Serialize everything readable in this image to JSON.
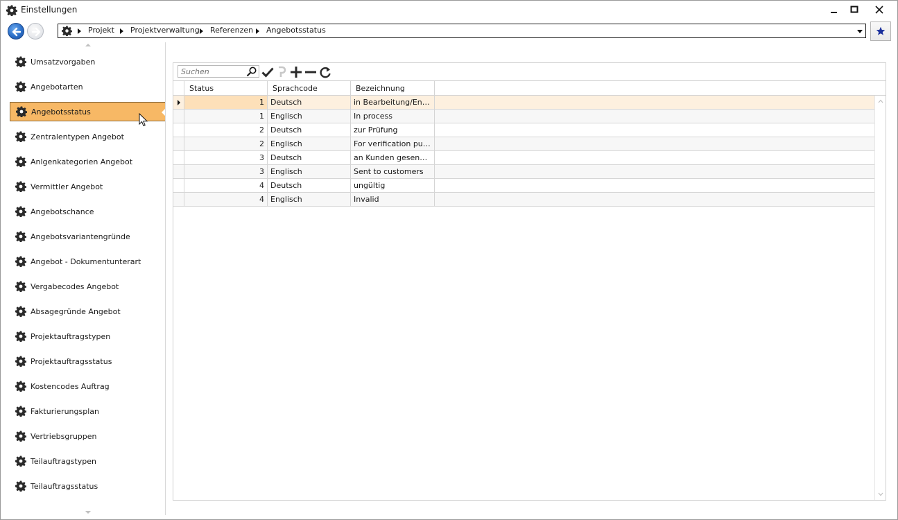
{
  "window": {
    "title": "Einstellungen"
  },
  "breadcrumb": [
    "Projekt",
    "Projektverwaltung",
    "Referenzen",
    "Angebotsstatus"
  ],
  "sidebar": {
    "selected_index": 2,
    "items": [
      "Umsatzvorgaben",
      "Angebotarten",
      "Angebotsstatus",
      "Zentralentypen Angebot",
      "Anlgenkategorien Angebot",
      "Vermittler Angebot",
      "Angebotschance",
      "Angebotsvariantengründe",
      "Angebot - Dokumentunterart",
      "Vergabecodes Angebot",
      "Absagegründe Angebot",
      "Projektauftragstypen",
      "Projektauftragsstatus",
      "Kostencodes Auftrag",
      "Fakturierungsplan",
      "Vertriebsgruppen",
      "Teilauftragstypen",
      "Teilauftragsstatus"
    ]
  },
  "search": {
    "placeholder": "Suchen"
  },
  "grid": {
    "columns": [
      "Status",
      "Sprachcode",
      "Bezeichnung"
    ],
    "current_row": 0,
    "rows": [
      {
        "status": "1",
        "lang": "Deutsch",
        "desc": "in Bearbeitung/Entwurf"
      },
      {
        "status": "1",
        "lang": "Englisch",
        "desc": "In process"
      },
      {
        "status": "2",
        "lang": "Deutsch",
        "desc": "zur Prüfung"
      },
      {
        "status": "2",
        "lang": "Englisch",
        "desc": "For verification purposes"
      },
      {
        "status": "3",
        "lang": "Deutsch",
        "desc": "an Kunden gesendet"
      },
      {
        "status": "3",
        "lang": "Englisch",
        "desc": "Sent to customers"
      },
      {
        "status": "4",
        "lang": "Deutsch",
        "desc": "ungültig"
      },
      {
        "status": "4",
        "lang": "Englisch",
        "desc": "Invalid"
      }
    ]
  },
  "colors": {
    "selected_bg": "#f7b865",
    "current_row_bg": "#fdf0df",
    "accent_blue": "#2b6fc8",
    "star": "#1a2f9c"
  },
  "icons": [
    "gear-icon",
    "back-arrow-icon",
    "forward-arrow-icon",
    "chevron-right-icon",
    "dropdown-arrow-icon",
    "star-icon",
    "search-icon",
    "checkmark-icon",
    "undo-icon",
    "plus-icon",
    "minus-icon",
    "refresh-icon",
    "minimize-icon",
    "maximize-icon",
    "close-icon"
  ]
}
